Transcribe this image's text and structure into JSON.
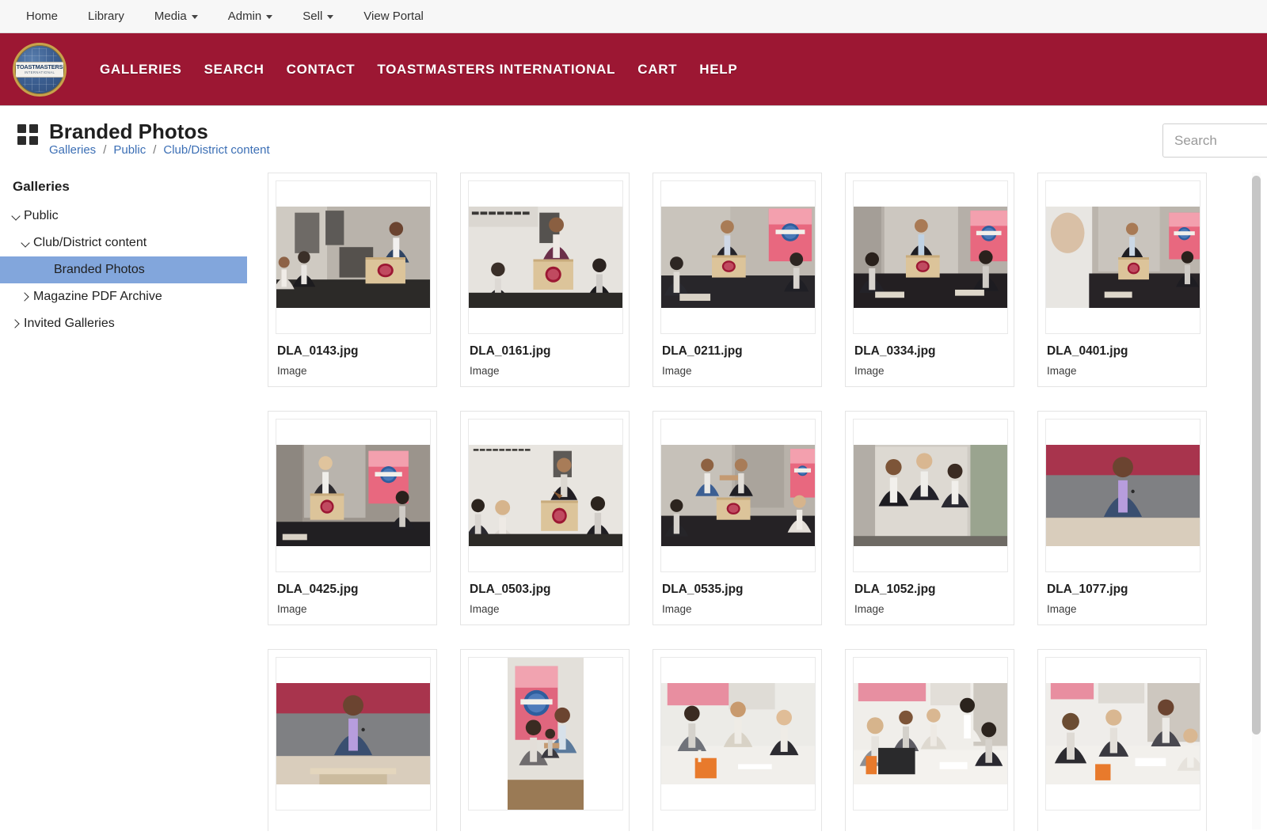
{
  "topnav": {
    "items": [
      {
        "label": "Home",
        "has_caret": false
      },
      {
        "label": "Library",
        "has_caret": false
      },
      {
        "label": "Media",
        "has_caret": true
      },
      {
        "label": "Admin",
        "has_caret": true
      },
      {
        "label": "Sell",
        "has_caret": true
      },
      {
        "label": "View Portal",
        "has_caret": false
      }
    ]
  },
  "brandbar": {
    "background_color": "#9c1733",
    "logo": {
      "line1": "TOASTMASTERS",
      "line2": "INTERNATIONAL"
    },
    "items": [
      "GALLERIES",
      "SEARCH",
      "CONTACT",
      "TOASTMASTERS INTERNATIONAL",
      "CART",
      "HELP"
    ]
  },
  "pagehead": {
    "title": "Branded Photos",
    "breadcrumb": [
      {
        "label": "Galleries"
      },
      {
        "label": "Public"
      },
      {
        "label": "Club/District content"
      }
    ],
    "breadcrumb_separator": "/",
    "breadcrumb_color": "#3c6fb5",
    "search": {
      "placeholder": "Search",
      "value": ""
    }
  },
  "sidebar": {
    "heading": "Galleries",
    "selected_color": "#82a6dc",
    "items": [
      {
        "label": "Public",
        "level": 1,
        "chevron": "down",
        "selected": false
      },
      {
        "label": "Club/District content",
        "level": 2,
        "chevron": "down",
        "selected": false
      },
      {
        "label": "Branded Photos",
        "level": 3,
        "chevron": "none",
        "selected": true
      },
      {
        "label": "Magazine PDF Archive",
        "level": 2,
        "chevron": "right",
        "selected": false
      },
      {
        "label": "Invited Galleries",
        "level": 1,
        "chevron": "right",
        "selected": false
      }
    ]
  },
  "gallery": {
    "items": [
      {
        "name": "DLA_0143.jpg",
        "type": "Image",
        "scene": "podium-speaker-audience",
        "orientation": "landscape"
      },
      {
        "name": "DLA_0161.jpg",
        "type": "Image",
        "scene": "standing-speaker-lectern",
        "orientation": "landscape"
      },
      {
        "name": "DLA_0211.jpg",
        "type": "Image",
        "scene": "meeting-room-banner",
        "orientation": "landscape"
      },
      {
        "name": "DLA_0334.jpg",
        "type": "Image",
        "scene": "boardroom-presenter",
        "orientation": "landscape"
      },
      {
        "name": "DLA_0401.jpg",
        "type": "Image",
        "scene": "over-shoulder-presenter",
        "orientation": "landscape"
      },
      {
        "name": "DLA_0425.jpg",
        "type": "Image",
        "scene": "speaker-with-banner",
        "orientation": "landscape"
      },
      {
        "name": "DLA_0503.jpg",
        "type": "Image",
        "scene": "gavel-speaker-seated-audience",
        "orientation": "landscape"
      },
      {
        "name": "DLA_0535.jpg",
        "type": "Image",
        "scene": "handshake-at-lectern",
        "orientation": "landscape"
      },
      {
        "name": "DLA_1052.jpg",
        "type": "Image",
        "scene": "group-celebrating",
        "orientation": "landscape"
      },
      {
        "name": "DLA_1077.jpg",
        "type": "Image",
        "scene": "man-with-microphone",
        "orientation": "landscape"
      },
      {
        "name": "",
        "type": "",
        "scene": "man-at-lectern-smiling",
        "orientation": "landscape"
      },
      {
        "name": "",
        "type": "",
        "scene": "handshake-portrait-banner",
        "orientation": "portrait"
      },
      {
        "name": "",
        "type": "",
        "scene": "office-table-discussion",
        "orientation": "landscape"
      },
      {
        "name": "",
        "type": "",
        "scene": "office-collaboration-laptop",
        "orientation": "landscape"
      },
      {
        "name": "",
        "type": "",
        "scene": "office-team-papers",
        "orientation": "landscape"
      }
    ]
  },
  "scrollbar": {
    "orientation": "vertical",
    "thumb_color": "#c6c6c6"
  }
}
